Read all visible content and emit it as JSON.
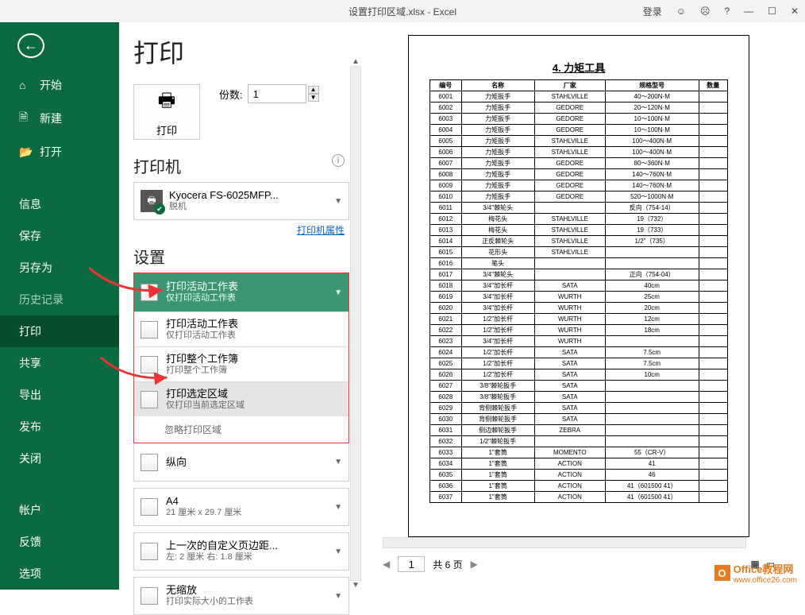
{
  "title_doc": "设置打印区域.xlsx  -  Excel",
  "title_login": "登录",
  "sidebar": {
    "items": [
      {
        "label": "开始"
      },
      {
        "label": "新建"
      },
      {
        "label": "打开"
      },
      {
        "label": "信息"
      },
      {
        "label": "保存"
      },
      {
        "label": "另存为"
      },
      {
        "label": "历史记录"
      },
      {
        "label": "打印"
      },
      {
        "label": "共享"
      },
      {
        "label": "导出"
      },
      {
        "label": "发布"
      },
      {
        "label": "关闭"
      },
      {
        "label": "帐户"
      },
      {
        "label": "反馈"
      },
      {
        "label": "选项"
      }
    ]
  },
  "print": {
    "heading": "打印",
    "button_label": "打印",
    "copies_label": "份数:",
    "copies_value": "1",
    "printer_heading": "打印机",
    "printer_name": "Kyocera FS-6025MFP...",
    "printer_status": "脱机",
    "printer_props": "打印机属性",
    "settings_heading": "设置",
    "dd_selected_title": "打印活动工作表",
    "dd_selected_sub": "仅打印活动工作表",
    "dd_items": [
      {
        "title": "打印活动工作表",
        "sub": "仅打印活动工作表"
      },
      {
        "title": "打印整个工作簿",
        "sub": "打印整个工作簿"
      },
      {
        "title": "打印选定区域",
        "sub": "仅打印当前选定区域"
      }
    ],
    "dd_ignore": "忽略打印区域",
    "orient_title": "纵向",
    "paper_title": "A4",
    "paper_sub": "21 厘米 x 29.7 厘米",
    "margin_title": "上一次的自定义页边距...",
    "margin_sub": "左: 2 厘米   右: 1.8 厘米",
    "scale_title": "无缩放",
    "scale_sub": "打印实际大小的工作表"
  },
  "pager": {
    "page": "1",
    "total": "共 6 页"
  },
  "preview": {
    "title": "4. 力矩工具",
    "headers": [
      "编号",
      "名称",
      "厂家",
      "规格型号",
      "数量"
    ],
    "rows": [
      [
        "6001",
        "力矩扳手",
        "STAHLVILLE",
        "40～200N·M",
        ""
      ],
      [
        "6002",
        "力矩扳手",
        "GEDORE",
        "20～120N·M",
        ""
      ],
      [
        "6003",
        "力矩扳手",
        "GEDORE",
        "10～100N·M",
        ""
      ],
      [
        "6004",
        "力矩扳手",
        "GEDORE",
        "10～100N·M",
        ""
      ],
      [
        "6005",
        "力矩扳手",
        "STAHLVILLE",
        "100～400N·M",
        ""
      ],
      [
        "6006",
        "力矩扳手",
        "STAHLVILLE",
        "100～400N·M",
        ""
      ],
      [
        "6007",
        "力矩扳手",
        "GEDORE",
        "80～360N·M",
        ""
      ],
      [
        "6008",
        "力矩扳手",
        "GEDORE",
        "140～760N·M",
        ""
      ],
      [
        "6009",
        "力矩扳手",
        "GEDORE",
        "140～760N·M",
        ""
      ],
      [
        "6010",
        "力矩扳手",
        "GEDORE",
        "520～1000N·M",
        ""
      ],
      [
        "6011",
        "3/4\"棘轮头",
        "",
        "反向（754-14）",
        ""
      ],
      [
        "6012",
        "梅花头",
        "STAHLVILLE",
        "19（732）",
        ""
      ],
      [
        "6013",
        "梅花头",
        "STAHLVILLE",
        "19（733）",
        ""
      ],
      [
        "6014",
        "正反棘轮头",
        "STAHLVILLE",
        "1/2\"（735）",
        ""
      ],
      [
        "6015",
        "花形头",
        "STAHLVILLE",
        "",
        ""
      ],
      [
        "6016",
        "笔头",
        "",
        "",
        ""
      ],
      [
        "6017",
        "3/4\"棘轮头",
        "",
        "正向（754-04）",
        ""
      ],
      [
        "6018",
        "3/4\"加长杆",
        "SATA",
        "40cm",
        ""
      ],
      [
        "6019",
        "3/4\"加长杆",
        "WURTH",
        "25cm",
        ""
      ],
      [
        "6020",
        "3/4\"加长杆",
        "WURTH",
        "20cm",
        ""
      ],
      [
        "6021",
        "1/2\"加长杆",
        "WURTH",
        "12cm",
        ""
      ],
      [
        "6022",
        "1/2\"加长杆",
        "WURTH",
        "18cm",
        ""
      ],
      [
        "6023",
        "3/4\"加长杆",
        "WURTH",
        "",
        ""
      ],
      [
        "6024",
        "1/2\"加长杆",
        "SATA",
        "7.5cm",
        ""
      ],
      [
        "6025",
        "1/2\"加长杆",
        "SATA",
        "7.5cm",
        ""
      ],
      [
        "6026",
        "1/2\"加长杆",
        "SATA",
        "10cm",
        ""
      ],
      [
        "6027",
        "3/8\"棘轮扳手",
        "SATA",
        "",
        ""
      ],
      [
        "6028",
        "3/8\"棘轮扳手",
        "SATA",
        "",
        ""
      ],
      [
        "6029",
        "背侧棘轮扳手",
        "SATA",
        "",
        ""
      ],
      [
        "6030",
        "背侧棘轮扳手",
        "SATA",
        "",
        ""
      ],
      [
        "6031",
        "侧边棘轮扳手",
        "ZEBRA",
        "",
        ""
      ],
      [
        "6032",
        "1/2\"棘轮扳手",
        "",
        "",
        ""
      ],
      [
        "6033",
        "1\"套筒",
        "MOMENTO",
        "55（CR-V）",
        ""
      ],
      [
        "6034",
        "1\"套筒",
        "ACTION",
        "41",
        ""
      ],
      [
        "6035",
        "1\"套筒",
        "ACTION",
        "46",
        ""
      ],
      [
        "6036",
        "1\"套筒",
        "ACTION",
        "41（601500 41）",
        ""
      ],
      [
        "6037",
        "1\"套筒",
        "ACTION",
        "41（601500 41）",
        ""
      ]
    ]
  },
  "logo": {
    "brand": "Office教程网",
    "url": "www.office26.com"
  }
}
